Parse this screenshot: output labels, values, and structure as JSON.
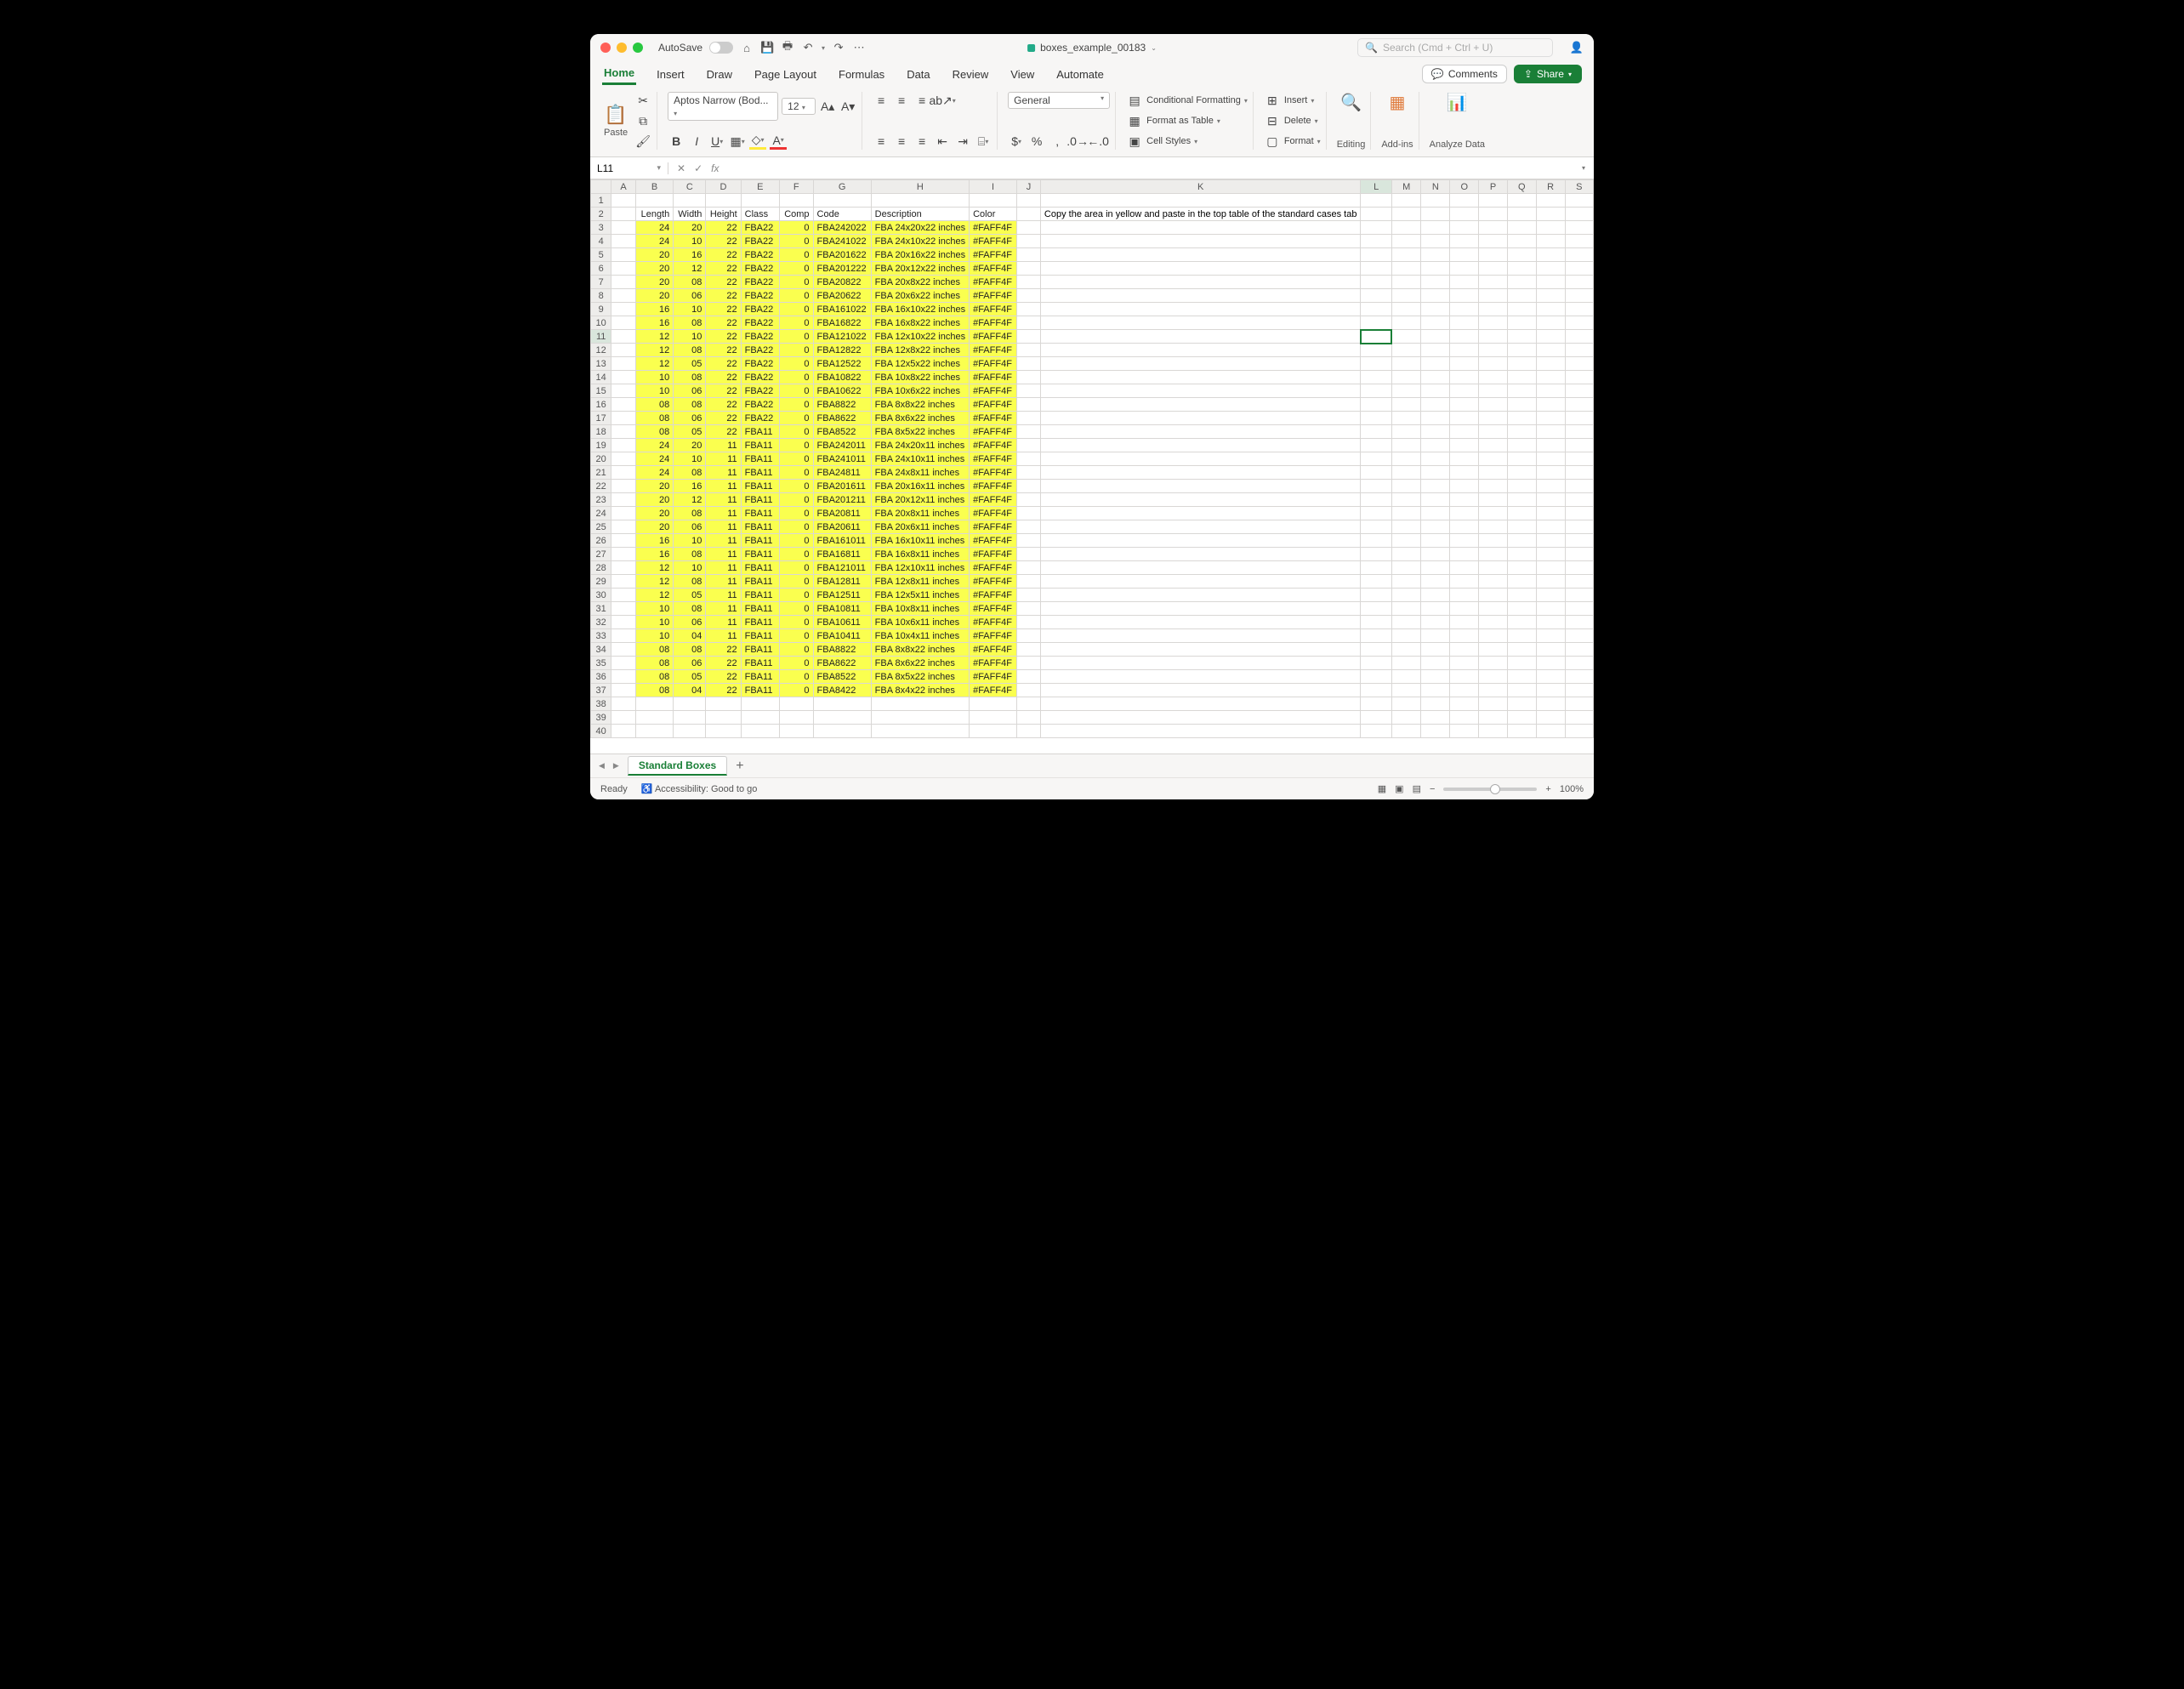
{
  "titlebar": {
    "autosave": "AutoSave",
    "filename": "boxes_example_00183",
    "search_placeholder": "Search (Cmd + Ctrl + U)"
  },
  "menu": {
    "tabs": [
      "Home",
      "Insert",
      "Draw",
      "Page Layout",
      "Formulas",
      "Data",
      "Review",
      "View",
      "Automate"
    ],
    "active": "Home",
    "comments": "Comments",
    "share": "Share"
  },
  "ribbon": {
    "paste": "Paste",
    "font_name": "Aptos Narrow (Bod...",
    "font_size": "12",
    "number_format": "General",
    "cond_fmt": "Conditional Formatting",
    "fmt_table": "Format as Table",
    "cell_styles": "Cell Styles",
    "insert": "Insert",
    "delete": "Delete",
    "format": "Format",
    "editing": "Editing",
    "addins": "Add-ins",
    "analyze": "Analyze Data"
  },
  "namebox": "L11",
  "columns": [
    "A",
    "B",
    "C",
    "D",
    "E",
    "F",
    "G",
    "H",
    "I",
    "J",
    "K",
    "L",
    "M",
    "N",
    "O",
    "P",
    "Q",
    "R",
    "S"
  ],
  "headers": {
    "B": "Length",
    "C": "Width",
    "D": "Height",
    "E": "Class",
    "F": "Comp",
    "G": "Code",
    "H": "Description",
    "I": "Color"
  },
  "instruction": "Copy the area in yellow and paste in the top table of the standard cases tab",
  "rows": [
    {
      "l": "24",
      "w": "20",
      "h": "22",
      "cls": "FBA22",
      "cmp": "0",
      "code": "FBA242022",
      "desc": "FBA 24x20x22 inches",
      "col": "#FAFF4F"
    },
    {
      "l": "24",
      "w": "10",
      "h": "22",
      "cls": "FBA22",
      "cmp": "0",
      "code": "FBA241022",
      "desc": "FBA 24x10x22 inches",
      "col": "#FAFF4F"
    },
    {
      "l": "20",
      "w": "16",
      "h": "22",
      "cls": "FBA22",
      "cmp": "0",
      "code": "FBA201622",
      "desc": "FBA 20x16x22 inches",
      "col": "#FAFF4F"
    },
    {
      "l": "20",
      "w": "12",
      "h": "22",
      "cls": "FBA22",
      "cmp": "0",
      "code": "FBA201222",
      "desc": "FBA 20x12x22 inches",
      "col": "#FAFF4F"
    },
    {
      "l": "20",
      "w": "08",
      "h": "22",
      "cls": "FBA22",
      "cmp": "0",
      "code": "FBA20822",
      "desc": "FBA 20x8x22 inches",
      "col": "#FAFF4F"
    },
    {
      "l": "20",
      "w": "06",
      "h": "22",
      "cls": "FBA22",
      "cmp": "0",
      "code": "FBA20622",
      "desc": "FBA 20x6x22 inches",
      "col": "#FAFF4F"
    },
    {
      "l": "16",
      "w": "10",
      "h": "22",
      "cls": "FBA22",
      "cmp": "0",
      "code": "FBA161022",
      "desc": "FBA 16x10x22 inches",
      "col": "#FAFF4F"
    },
    {
      "l": "16",
      "w": "08",
      "h": "22",
      "cls": "FBA22",
      "cmp": "0",
      "code": "FBA16822",
      "desc": "FBA 16x8x22 inches",
      "col": "#FAFF4F"
    },
    {
      "l": "12",
      "w": "10",
      "h": "22",
      "cls": "FBA22",
      "cmp": "0",
      "code": "FBA121022",
      "desc": "FBA 12x10x22 inches",
      "col": "#FAFF4F"
    },
    {
      "l": "12",
      "w": "08",
      "h": "22",
      "cls": "FBA22",
      "cmp": "0",
      "code": "FBA12822",
      "desc": "FBA 12x8x22 inches",
      "col": "#FAFF4F"
    },
    {
      "l": "12",
      "w": "05",
      "h": "22",
      "cls": "FBA22",
      "cmp": "0",
      "code": "FBA12522",
      "desc": "FBA 12x5x22 inches",
      "col": "#FAFF4F"
    },
    {
      "l": "10",
      "w": "08",
      "h": "22",
      "cls": "FBA22",
      "cmp": "0",
      "code": "FBA10822",
      "desc": "FBA 10x8x22 inches",
      "col": "#FAFF4F"
    },
    {
      "l": "10",
      "w": "06",
      "h": "22",
      "cls": "FBA22",
      "cmp": "0",
      "code": "FBA10622",
      "desc": "FBA 10x6x22 inches",
      "col": "#FAFF4F"
    },
    {
      "l": "08",
      "w": "08",
      "h": "22",
      "cls": "FBA22",
      "cmp": "0",
      "code": "FBA8822",
      "desc": "FBA 8x8x22 inches",
      "col": "#FAFF4F"
    },
    {
      "l": "08",
      "w": "06",
      "h": "22",
      "cls": "FBA22",
      "cmp": "0",
      "code": "FBA8622",
      "desc": "FBA 8x6x22 inches",
      "col": "#FAFF4F"
    },
    {
      "l": "08",
      "w": "05",
      "h": "22",
      "cls": "FBA11",
      "cmp": "0",
      "code": "FBA8522",
      "desc": "FBA 8x5x22 inches",
      "col": "#FAFF4F"
    },
    {
      "l": "24",
      "w": "20",
      "h": "11",
      "cls": "FBA11",
      "cmp": "0",
      "code": "FBA242011",
      "desc": "FBA 24x20x11 inches",
      "col": "#FAFF4F"
    },
    {
      "l": "24",
      "w": "10",
      "h": "11",
      "cls": "FBA11",
      "cmp": "0",
      "code": "FBA241011",
      "desc": "FBA 24x10x11 inches",
      "col": "#FAFF4F"
    },
    {
      "l": "24",
      "w": "08",
      "h": "11",
      "cls": "FBA11",
      "cmp": "0",
      "code": "FBA24811",
      "desc": "FBA 24x8x11 inches",
      "col": "#FAFF4F"
    },
    {
      "l": "20",
      "w": "16",
      "h": "11",
      "cls": "FBA11",
      "cmp": "0",
      "code": "FBA201611",
      "desc": "FBA 20x16x11 inches",
      "col": "#FAFF4F"
    },
    {
      "l": "20",
      "w": "12",
      "h": "11",
      "cls": "FBA11",
      "cmp": "0",
      "code": "FBA201211",
      "desc": "FBA 20x12x11 inches",
      "col": "#FAFF4F"
    },
    {
      "l": "20",
      "w": "08",
      "h": "11",
      "cls": "FBA11",
      "cmp": "0",
      "code": "FBA20811",
      "desc": "FBA 20x8x11 inches",
      "col": "#FAFF4F"
    },
    {
      "l": "20",
      "w": "06",
      "h": "11",
      "cls": "FBA11",
      "cmp": "0",
      "code": "FBA20611",
      "desc": "FBA 20x6x11 inches",
      "col": "#FAFF4F"
    },
    {
      "l": "16",
      "w": "10",
      "h": "11",
      "cls": "FBA11",
      "cmp": "0",
      "code": "FBA161011",
      "desc": "FBA 16x10x11 inches",
      "col": "#FAFF4F"
    },
    {
      "l": "16",
      "w": "08",
      "h": "11",
      "cls": "FBA11",
      "cmp": "0",
      "code": "FBA16811",
      "desc": "FBA 16x8x11 inches",
      "col": "#FAFF4F"
    },
    {
      "l": "12",
      "w": "10",
      "h": "11",
      "cls": "FBA11",
      "cmp": "0",
      "code": "FBA121011",
      "desc": "FBA 12x10x11 inches",
      "col": "#FAFF4F"
    },
    {
      "l": "12",
      "w": "08",
      "h": "11",
      "cls": "FBA11",
      "cmp": "0",
      "code": "FBA12811",
      "desc": "FBA 12x8x11 inches",
      "col": "#FAFF4F"
    },
    {
      "l": "12",
      "w": "05",
      "h": "11",
      "cls": "FBA11",
      "cmp": "0",
      "code": "FBA12511",
      "desc": "FBA 12x5x11 inches",
      "col": "#FAFF4F"
    },
    {
      "l": "10",
      "w": "08",
      "h": "11",
      "cls": "FBA11",
      "cmp": "0",
      "code": "FBA10811",
      "desc": "FBA 10x8x11 inches",
      "col": "#FAFF4F"
    },
    {
      "l": "10",
      "w": "06",
      "h": "11",
      "cls": "FBA11",
      "cmp": "0",
      "code": "FBA10611",
      "desc": "FBA 10x6x11 inches",
      "col": "#FAFF4F"
    },
    {
      "l": "10",
      "w": "04",
      "h": "11",
      "cls": "FBA11",
      "cmp": "0",
      "code": "FBA10411",
      "desc": "FBA 10x4x11 inches",
      "col": "#FAFF4F"
    },
    {
      "l": "08",
      "w": "08",
      "h": "22",
      "cls": "FBA11",
      "cmp": "0",
      "code": "FBA8822",
      "desc": "FBA 8x8x22 inches",
      "col": "#FAFF4F"
    },
    {
      "l": "08",
      "w": "06",
      "h": "22",
      "cls": "FBA11",
      "cmp": "0",
      "code": "FBA8622",
      "desc": "FBA 8x6x22 inches",
      "col": "#FAFF4F"
    },
    {
      "l": "08",
      "w": "05",
      "h": "22",
      "cls": "FBA11",
      "cmp": "0",
      "code": "FBA8522",
      "desc": "FBA 8x5x22 inches",
      "col": "#FAFF4F"
    },
    {
      "l": "08",
      "w": "04",
      "h": "22",
      "cls": "FBA11",
      "cmp": "0",
      "code": "FBA8422",
      "desc": "FBA 8x4x22 inches",
      "col": "#FAFF4F"
    }
  ],
  "blank_rows": [
    38,
    39,
    40
  ],
  "sheet": {
    "name": "Standard Boxes"
  },
  "status": {
    "ready": "Ready",
    "acc": "Accessibility: Good to go",
    "zoom": "100%"
  }
}
